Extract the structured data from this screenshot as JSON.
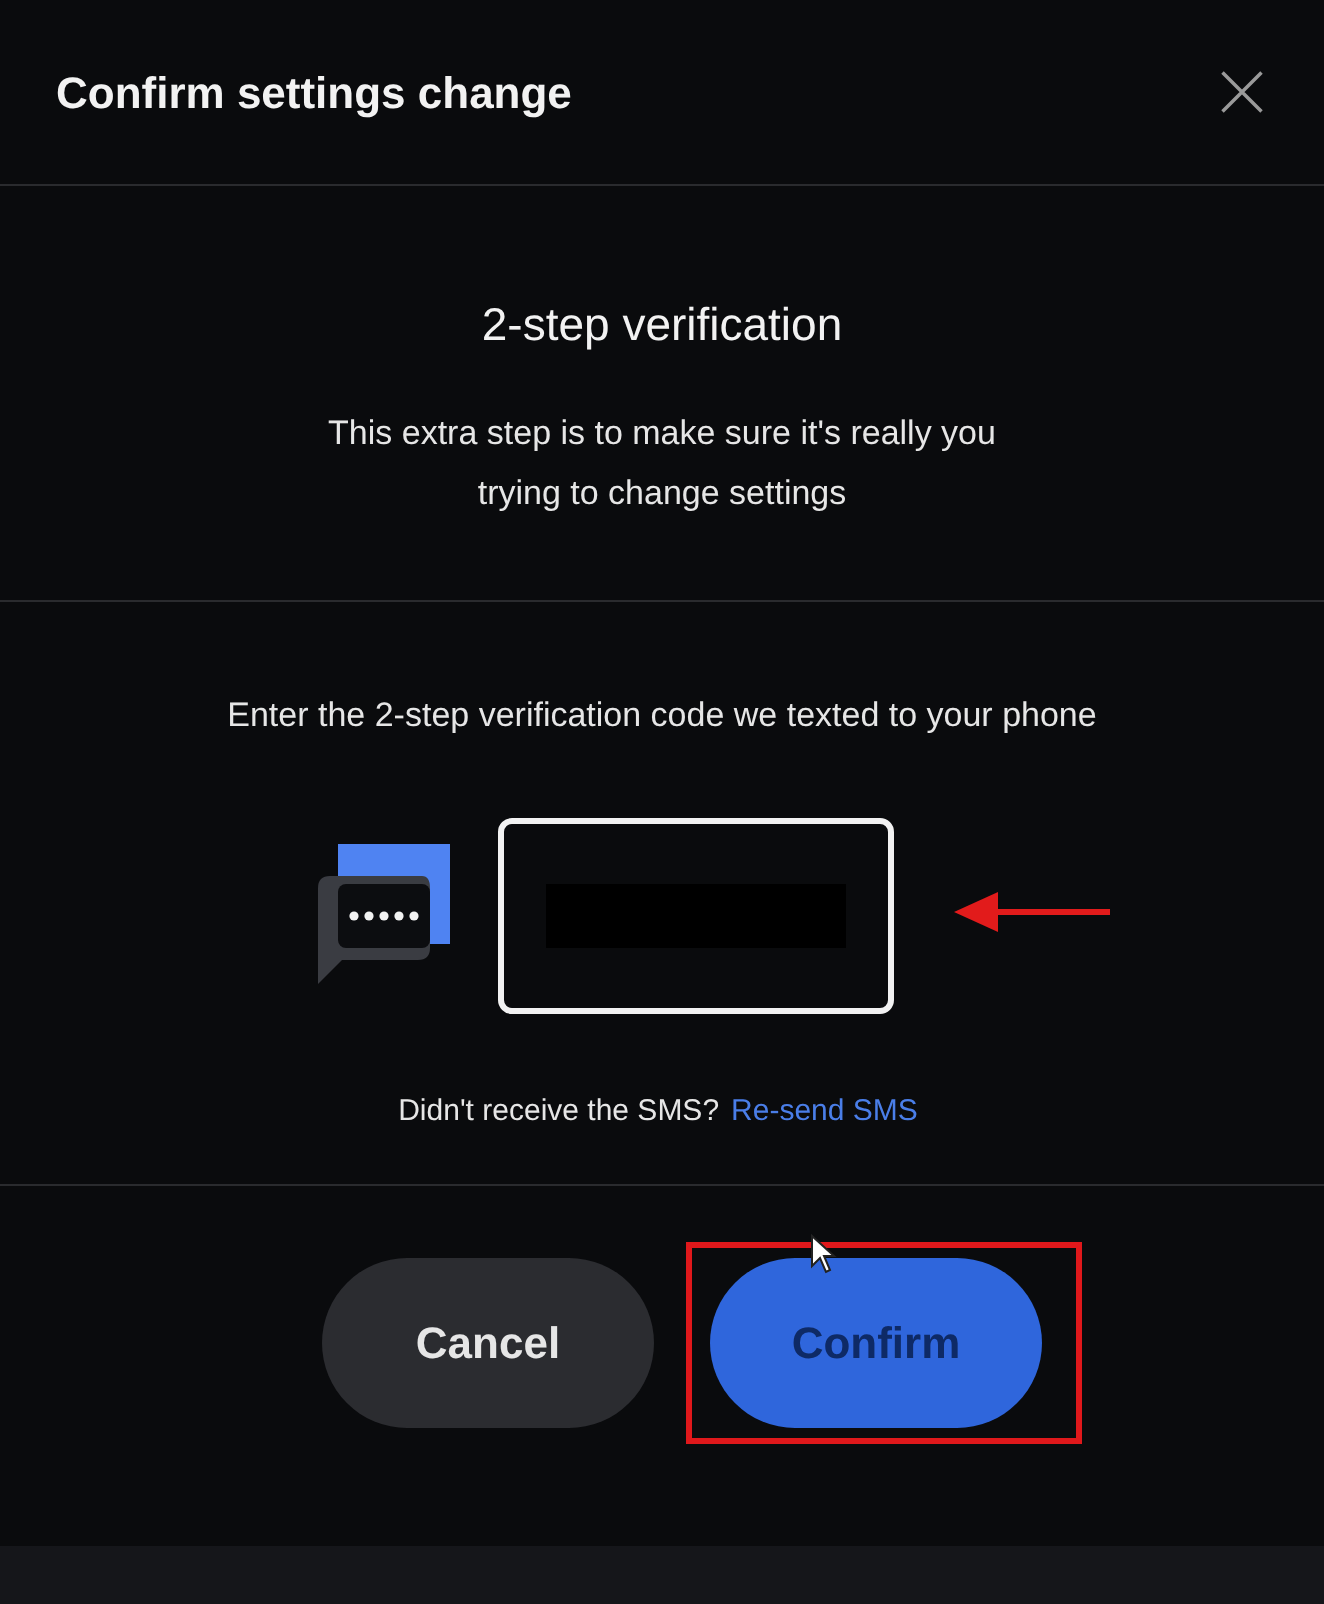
{
  "dialog": {
    "title": "Confirm settings change"
  },
  "intro": {
    "heading": "2-step verification",
    "text": "This extra step is to make sure it's really you trying to change settings"
  },
  "verification": {
    "prompt": "Enter the 2-step verification code we texted to your phone",
    "code_field": {
      "redacted": true,
      "pointed_at": true
    },
    "resend": {
      "question": "Didn't receive the SMS?",
      "link": "Re-send SMS"
    }
  },
  "buttons": [
    {
      "label": "Cancel",
      "kind": "secondary"
    },
    {
      "label": "Confirm",
      "kind": "primary",
      "highlighted": true
    }
  ]
}
